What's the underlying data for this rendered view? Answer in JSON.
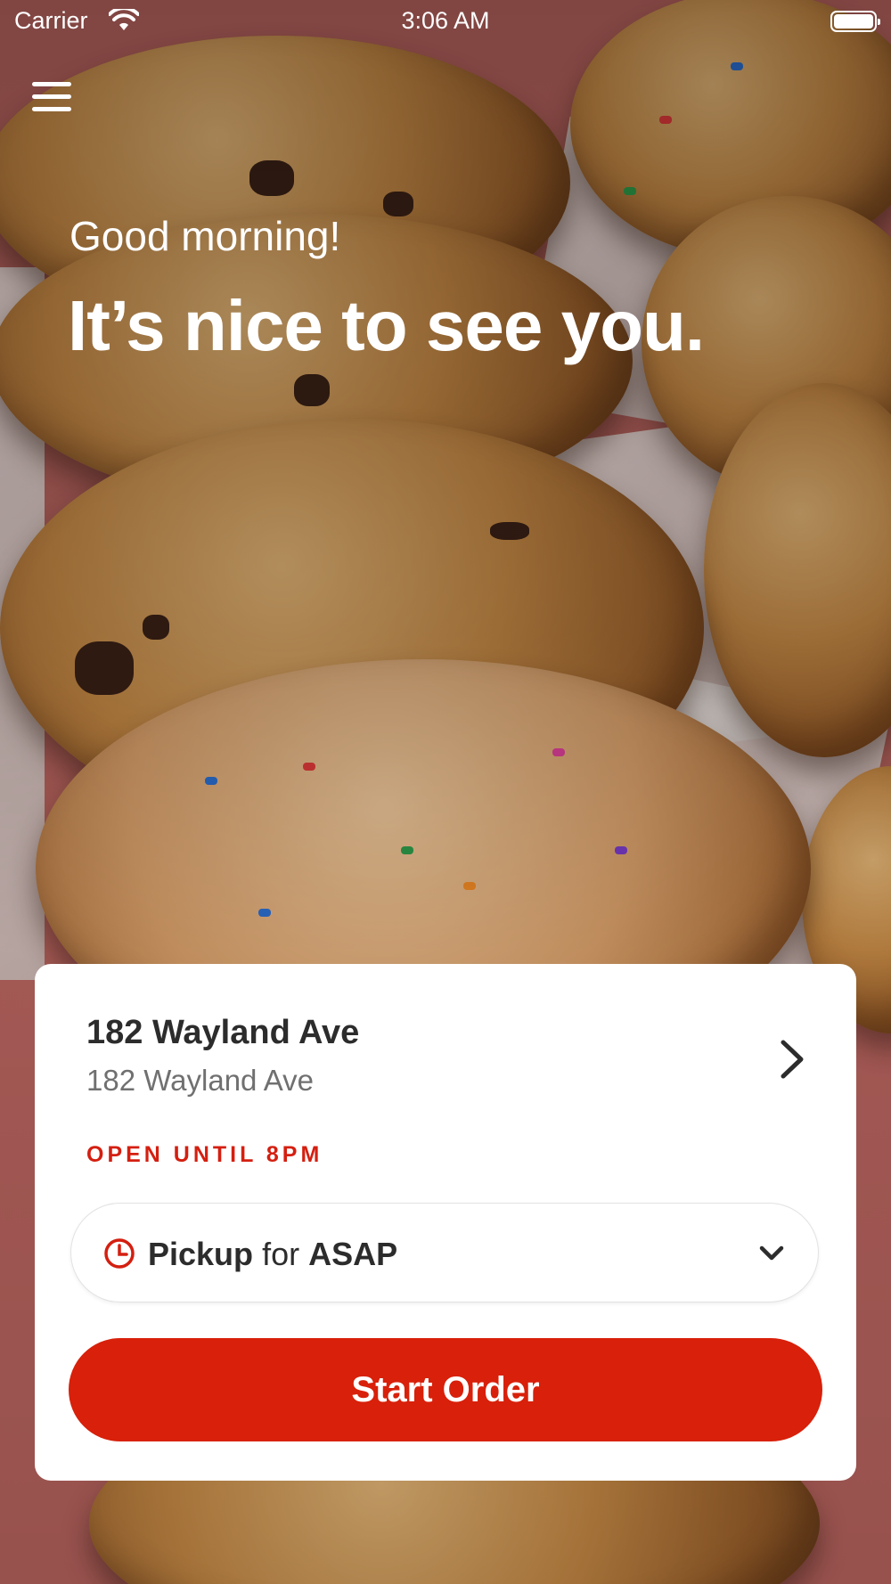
{
  "status_bar": {
    "carrier": "Carrier",
    "time": "3:06 AM"
  },
  "hero": {
    "greeting": "Good morning!",
    "headline": "It’s nice to see you."
  },
  "location_card": {
    "store_name": "182 Wayland Ave",
    "store_address": "182 Wayland Ave",
    "hours_status": "OPEN UNTIL 8PM",
    "order_type": {
      "mode": "Pickup",
      "connector": "for",
      "time": "ASAP"
    },
    "start_button_label": "Start Order"
  },
  "colors": {
    "accent_red": "#d8200a",
    "status_red": "#d41f10",
    "card_bg": "#ffffff"
  },
  "icons": [
    "menu-icon",
    "wifi-icon",
    "battery-icon",
    "chevron-right-icon",
    "clock-icon",
    "chevron-down-icon"
  ]
}
